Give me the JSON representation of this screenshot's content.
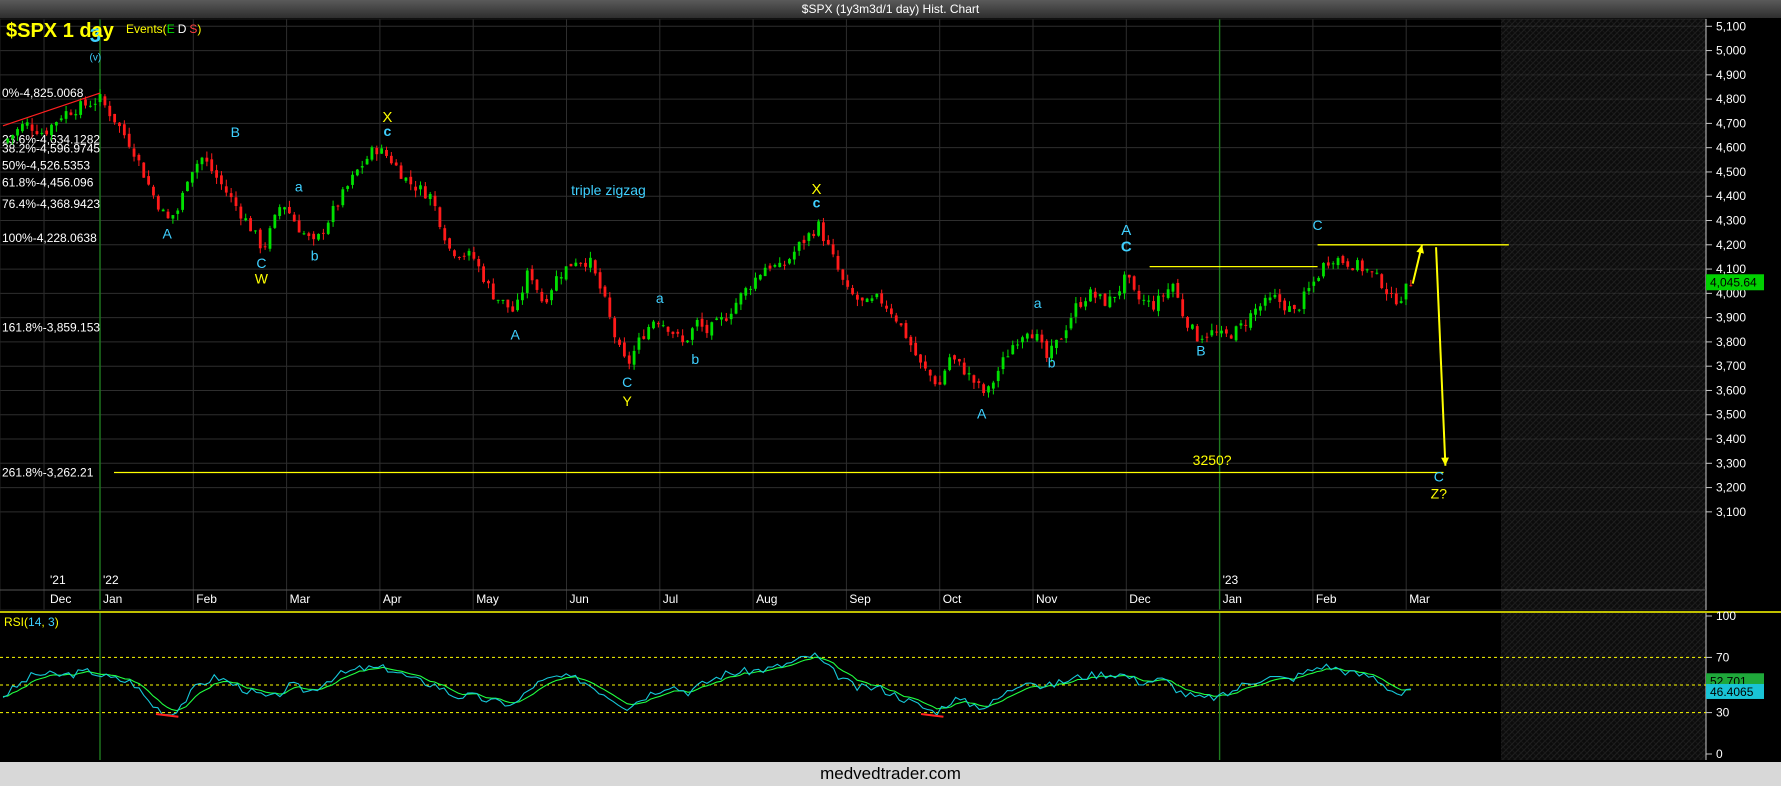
{
  "window": {
    "title": "$SPX (1y3m3d/1 day) Hist. Chart"
  },
  "footer": {
    "site": "medvedtrader.com"
  },
  "colors": {
    "up": "#00e000",
    "down": "#ff1a1a",
    "yellow": "#ffff00",
    "cyan": "#3fd0ff",
    "grid": "#2e2e2e",
    "axis": "#c9c9c9",
    "fib": "#ffffff",
    "rsi1": "#16c7d8",
    "rsi2": "#20ff40",
    "priceBadge": "#00d000"
  },
  "chart_data": [
    {
      "type": "candlestick",
      "title": "$SPX 1 day",
      "events_label": {
        "prefix": "Events(",
        "E": "E",
        "D": "D",
        "S": "S",
        "suffix": ")"
      },
      "ylim": [
        3050,
        5130
      ],
      "yticks": [
        "5,100",
        "5,000",
        "4,900",
        "4,800",
        "4,700",
        "4,600",
        "4,500",
        "4,400",
        "4,300",
        "4,200",
        "4,100",
        "4,000",
        "3,900",
        "3,800",
        "3,700",
        "3,600",
        "3,500",
        "3,400",
        "3,300",
        "3,200",
        "3,100"
      ],
      "ytick_values": [
        5100,
        5000,
        4900,
        4800,
        4700,
        4600,
        4500,
        4400,
        4300,
        4200,
        4100,
        4000,
        3900,
        3800,
        3700,
        3600,
        3500,
        3400,
        3300,
        3200,
        3100
      ],
      "x_labels": [
        {
          "t": "'21",
          "x": -0.6,
          "row": 1
        },
        {
          "t": "Dec",
          "x": -0.6,
          "row": 2
        },
        {
          "t": "'22",
          "x": 0,
          "row": 1
        },
        {
          "t": "Jan",
          "x": 0,
          "row": 2
        },
        {
          "t": "Feb",
          "x": 1,
          "row": 2
        },
        {
          "t": "Mar",
          "x": 2,
          "row": 2
        },
        {
          "t": "Apr",
          "x": 3,
          "row": 2
        },
        {
          "t": "May",
          "x": 4,
          "row": 2
        },
        {
          "t": "Jun",
          "x": 5,
          "row": 2
        },
        {
          "t": "Jul",
          "x": 6,
          "row": 2
        },
        {
          "t": "Aug",
          "x": 7,
          "row": 2
        },
        {
          "t": "Sep",
          "x": 8,
          "row": 2
        },
        {
          "t": "Oct",
          "x": 9,
          "row": 2
        },
        {
          "t": "Nov",
          "x": 10,
          "row": 2
        },
        {
          "t": "Dec",
          "x": 11,
          "row": 2
        },
        {
          "t": "'23",
          "x": 12,
          "row": 1
        },
        {
          "t": "Jan",
          "x": 12,
          "row": 2
        },
        {
          "t": "Feb",
          "x": 13,
          "row": 2
        },
        {
          "t": "Mar",
          "x": 14,
          "row": 2
        }
      ],
      "x_unit": "months since Jan 2022",
      "last_price": "4,045.64",
      "last_value": 4045.64,
      "path": [
        [
          -1.04,
          4620
        ],
        [
          -0.8,
          4700
        ],
        [
          -0.6,
          4660
        ],
        [
          -0.4,
          4740
        ],
        [
          -0.2,
          4770
        ],
        [
          0,
          4800
        ],
        [
          0.15,
          4720
        ],
        [
          0.35,
          4600
        ],
        [
          0.55,
          4420
        ],
        [
          0.72,
          4300
        ],
        [
          0.85,
          4350
        ],
        [
          0.95,
          4500
        ],
        [
          1.1,
          4560
        ],
        [
          1.35,
          4420
        ],
        [
          1.6,
          4280
        ],
        [
          1.75,
          4180
        ],
        [
          1.95,
          4380
        ],
        [
          2.15,
          4260
        ],
        [
          2.3,
          4200
        ],
        [
          2.5,
          4340
        ],
        [
          2.75,
          4500
        ],
        [
          2.95,
          4600
        ],
        [
          3.1,
          4560
        ],
        [
          3.3,
          4460
        ],
        [
          3.55,
          4400
        ],
        [
          3.75,
          4180
        ],
        [
          4.0,
          4150
        ],
        [
          4.2,
          4000
        ],
        [
          4.45,
          3920
        ],
        [
          4.6,
          4100
        ],
        [
          4.75,
          3960
        ],
        [
          4.9,
          4070
        ],
        [
          5.1,
          4140
        ],
        [
          5.25,
          4130
        ],
        [
          5.4,
          3980
        ],
        [
          5.55,
          3780
        ],
        [
          5.65,
          3700
        ],
        [
          5.8,
          3820
        ],
        [
          5.95,
          3900
        ],
        [
          6.1,
          3860
        ],
        [
          6.25,
          3790
        ],
        [
          6.4,
          3880
        ],
        [
          6.5,
          3840
        ],
        [
          6.7,
          3900
        ],
        [
          6.85,
          3980
        ],
        [
          7.0,
          4050
        ],
        [
          7.15,
          4120
        ],
        [
          7.3,
          4100
        ],
        [
          7.5,
          4200
        ],
        [
          7.7,
          4280
        ],
        [
          7.85,
          4150
        ],
        [
          8.0,
          4010
        ],
        [
          8.2,
          3950
        ],
        [
          8.35,
          3980
        ],
        [
          8.5,
          3920
        ],
        [
          8.65,
          3820
        ],
        [
          8.8,
          3700
        ],
        [
          9.0,
          3620
        ],
        [
          9.1,
          3740
        ],
        [
          9.25,
          3690
        ],
        [
          9.4,
          3620
        ],
        [
          9.5,
          3580
        ],
        [
          9.65,
          3700
        ],
        [
          9.8,
          3800
        ],
        [
          9.95,
          3860
        ],
        [
          10.05,
          3810
        ],
        [
          10.15,
          3730
        ],
        [
          10.3,
          3820
        ],
        [
          10.45,
          3940
        ],
        [
          10.6,
          4000
        ],
        [
          10.8,
          3960
        ],
        [
          10.95,
          4030
        ],
        [
          11.0,
          4070
        ],
        [
          11.1,
          3980
        ],
        [
          11.3,
          3950
        ],
        [
          11.5,
          4040
        ],
        [
          11.6,
          3920
        ],
        [
          11.75,
          3820
        ],
        [
          11.9,
          3840
        ],
        [
          12.05,
          3820
        ],
        [
          12.2,
          3850
        ],
        [
          12.4,
          3940
        ],
        [
          12.6,
          3980
        ],
        [
          12.8,
          3920
        ],
        [
          12.95,
          4010
        ],
        [
          13.05,
          4070
        ],
        [
          13.1,
          4110
        ],
        [
          13.2,
          4150
        ],
        [
          13.35,
          4130
        ],
        [
          13.5,
          4110
        ],
        [
          13.6,
          4090
        ],
        [
          13.75,
          4040
        ],
        [
          13.85,
          3970
        ],
        [
          13.95,
          3990
        ],
        [
          14.05,
          4045.64
        ]
      ],
      "fib_levels": [
        {
          "label": "0%-4,825.0068",
          "value": 4825
        },
        {
          "label": "23.6%-4,634.1282",
          "value": 4634
        },
        {
          "label": "38.2%-4,596.9745",
          "value": 4597
        },
        {
          "label": "50%-4,526.5353",
          "value": 4527
        },
        {
          "label": "61.8%-4,456.096",
          "value": 4456
        },
        {
          "label": "76.4%-4,368.9423",
          "value": 4369
        },
        {
          "label": "100%-4,228.0638",
          "value": 4228
        },
        {
          "label": "161.8%-3,859.153",
          "value": 3859
        },
        {
          "label": "261.8%-3,262.21",
          "value": 3262
        }
      ],
      "support_line": {
        "value": 3262,
        "x1": 0.15,
        "x2": 14.4
      },
      "resistance_lines": [
        {
          "value": 4110,
          "x1": 11.25,
          "x2": 13.05
        },
        {
          "value": 4200,
          "x1": 13.05,
          "x2": 15.1
        }
      ],
      "annotations": [
        {
          "t": "3",
          "x": -0.05,
          "v": 5035,
          "c": "cyan",
          "s": 20,
          "b": true
        },
        {
          "t": "(v)",
          "x": -0.05,
          "v": 4960,
          "c": "cyan",
          "s": 10
        },
        {
          "t": "A",
          "x": 0.72,
          "v": 4225,
          "c": "cyan",
          "s": 14
        },
        {
          "t": "B",
          "x": 1.45,
          "v": 4645,
          "c": "cyan",
          "s": 14
        },
        {
          "t": "C",
          "x": 1.73,
          "v": 4105,
          "c": "cyan",
          "s": 14
        },
        {
          "t": "W",
          "x": 1.73,
          "v": 4040,
          "c": "yellow",
          "s": 14
        },
        {
          "t": "a",
          "x": 2.13,
          "v": 4420,
          "c": "cyan",
          "s": 14
        },
        {
          "t": "b",
          "x": 2.3,
          "v": 4135,
          "c": "cyan",
          "s": 14
        },
        {
          "t": "X",
          "x": 3.08,
          "v": 4705,
          "c": "yellow",
          "s": 15
        },
        {
          "t": "c",
          "x": 3.08,
          "v": 4648,
          "c": "cyan",
          "s": 14,
          "b": true
        },
        {
          "t": "triple zigzag",
          "x": 5.45,
          "v": 4405,
          "c": "cyan",
          "s": 14
        },
        {
          "t": "A",
          "x": 4.45,
          "v": 3810,
          "c": "cyan",
          "s": 14
        },
        {
          "t": "a",
          "x": 6.0,
          "v": 3960,
          "c": "cyan",
          "s": 14
        },
        {
          "t": "b",
          "x": 6.38,
          "v": 3710,
          "c": "cyan",
          "s": 14
        },
        {
          "t": "C",
          "x": 5.65,
          "v": 3615,
          "c": "cyan",
          "s": 14
        },
        {
          "t": "Y",
          "x": 5.65,
          "v": 3535,
          "c": "yellow",
          "s": 14
        },
        {
          "t": "X",
          "x": 7.68,
          "v": 4410,
          "c": "yellow",
          "s": 15
        },
        {
          "t": "c",
          "x": 7.68,
          "v": 4353,
          "c": "cyan",
          "s": 14,
          "b": true
        },
        {
          "t": "A",
          "x": 9.45,
          "v": 3485,
          "c": "cyan",
          "s": 14
        },
        {
          "t": "a",
          "x": 10.05,
          "v": 3940,
          "c": "cyan",
          "s": 14
        },
        {
          "t": "b",
          "x": 10.2,
          "v": 3695,
          "c": "cyan",
          "s": 14
        },
        {
          "t": "A",
          "x": 11.0,
          "v": 4240,
          "c": "cyan",
          "s": 15
        },
        {
          "t": "C",
          "x": 11.0,
          "v": 4172,
          "c": "cyan",
          "s": 15,
          "b": true
        },
        {
          "t": "B",
          "x": 11.8,
          "v": 3745,
          "c": "cyan",
          "s": 14
        },
        {
          "t": "C",
          "x": 13.05,
          "v": 4260,
          "c": "cyan",
          "s": 14
        },
        {
          "t": "3250?",
          "x": 11.92,
          "v": 3292,
          "c": "yellow",
          "s": 14
        },
        {
          "t": "C",
          "x": 14.35,
          "v": 3225,
          "c": "cyan",
          "s": 14
        },
        {
          "t": "Z?",
          "x": 14.35,
          "v": 3155,
          "c": "yellow",
          "s": 14
        }
      ],
      "arrows": [
        {
          "from": [
            14.07,
            4040
          ],
          "to": [
            14.17,
            4200
          ],
          "c": "yellow"
        },
        {
          "from": [
            14.32,
            4190
          ],
          "to": [
            14.42,
            3290
          ],
          "c": "yellow"
        }
      ]
    },
    {
      "type": "line",
      "title": "RSI",
      "params": [
        "14",
        "3"
      ],
      "ylim": [
        0,
        100
      ],
      "yticks": [
        "100",
        "70",
        "30",
        "0"
      ],
      "ytick_values": [
        100,
        70,
        30,
        0
      ],
      "reference_lines": [
        70,
        50,
        30
      ],
      "last_value": "46.4065",
      "last_value_2": "52.701",
      "path": [
        [
          -1.04,
          42
        ],
        [
          -0.7,
          58
        ],
        [
          -0.4,
          57
        ],
        [
          -0.1,
          60
        ],
        [
          0.1,
          55
        ],
        [
          0.35,
          52
        ],
        [
          0.55,
          36
        ],
        [
          0.75,
          28
        ],
        [
          0.9,
          38
        ],
        [
          1.05,
          50
        ],
        [
          1.25,
          56
        ],
        [
          1.45,
          50
        ],
        [
          1.65,
          44
        ],
        [
          1.85,
          40
        ],
        [
          2.05,
          50
        ],
        [
          2.25,
          45
        ],
        [
          2.5,
          56
        ],
        [
          2.8,
          62
        ],
        [
          3.1,
          62
        ],
        [
          3.35,
          54
        ],
        [
          3.6,
          50
        ],
        [
          3.8,
          42
        ],
        [
          4.0,
          42
        ],
        [
          4.2,
          38
        ],
        [
          4.45,
          36
        ],
        [
          4.65,
          50
        ],
        [
          4.9,
          56
        ],
        [
          5.15,
          54
        ],
        [
          5.45,
          42
        ],
        [
          5.65,
          34
        ],
        [
          5.9,
          44
        ],
        [
          6.1,
          50
        ],
        [
          6.3,
          45
        ],
        [
          6.5,
          52
        ],
        [
          6.7,
          58
        ],
        [
          6.95,
          60
        ],
        [
          7.2,
          62
        ],
        [
          7.45,
          67
        ],
        [
          7.65,
          72
        ],
        [
          7.85,
          60
        ],
        [
          8.1,
          48
        ],
        [
          8.35,
          48
        ],
        [
          8.55,
          42
        ],
        [
          8.75,
          36
        ],
        [
          8.95,
          30
        ],
        [
          9.15,
          40
        ],
        [
          9.35,
          36
        ],
        [
          9.5,
          34
        ],
        [
          9.75,
          46
        ],
        [
          9.95,
          55
        ],
        [
          10.1,
          48
        ],
        [
          10.3,
          52
        ],
        [
          10.5,
          56
        ],
        [
          10.75,
          58
        ],
        [
          10.95,
          58
        ],
        [
          11.15,
          52
        ],
        [
          11.4,
          54
        ],
        [
          11.6,
          44
        ],
        [
          11.8,
          40
        ],
        [
          12.05,
          42
        ],
        [
          12.25,
          50
        ],
        [
          12.5,
          56
        ],
        [
          12.75,
          54
        ],
        [
          12.95,
          60
        ],
        [
          13.1,
          64
        ],
        [
          13.25,
          62
        ],
        [
          13.45,
          58
        ],
        [
          13.65,
          56
        ],
        [
          13.85,
          46
        ],
        [
          13.95,
          43
        ],
        [
          14.05,
          46
        ]
      ]
    }
  ]
}
